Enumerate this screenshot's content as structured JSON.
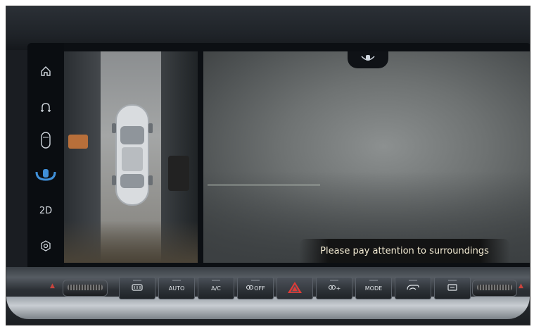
{
  "sidebar": {
    "items": [
      {
        "icon": "home-icon",
        "active": false
      },
      {
        "icon": "car-front-icon",
        "active": false
      },
      {
        "icon": "car-outline-icon",
        "active": false
      },
      {
        "icon": "surround-view-icon",
        "active": true
      },
      {
        "label": "2D",
        "active": false
      },
      {
        "icon": "settings-icon",
        "active": false
      }
    ]
  },
  "camera": {
    "warning_text": "Please pay attention to surroundings"
  },
  "climate_panel": {
    "buttons": [
      {
        "label": "",
        "icon": "rear-defrost-icon"
      },
      {
        "label": "AUTO",
        "icon": ""
      },
      {
        "label": "A/C",
        "icon": ""
      },
      {
        "label": "OFF",
        "icon": "fan-icon"
      },
      {
        "label": "",
        "icon": "hazard-icon"
      },
      {
        "label": "+",
        "icon": "fan-icon"
      },
      {
        "label": "MODE",
        "icon": ""
      },
      {
        "label": "",
        "icon": "recirculation-icon"
      },
      {
        "label": "",
        "icon": "front-defrost-icon"
      }
    ]
  },
  "colors": {
    "accent": "#3f8fd8",
    "hazard": "#e23a36",
    "warning_text": "#f2ead2"
  }
}
